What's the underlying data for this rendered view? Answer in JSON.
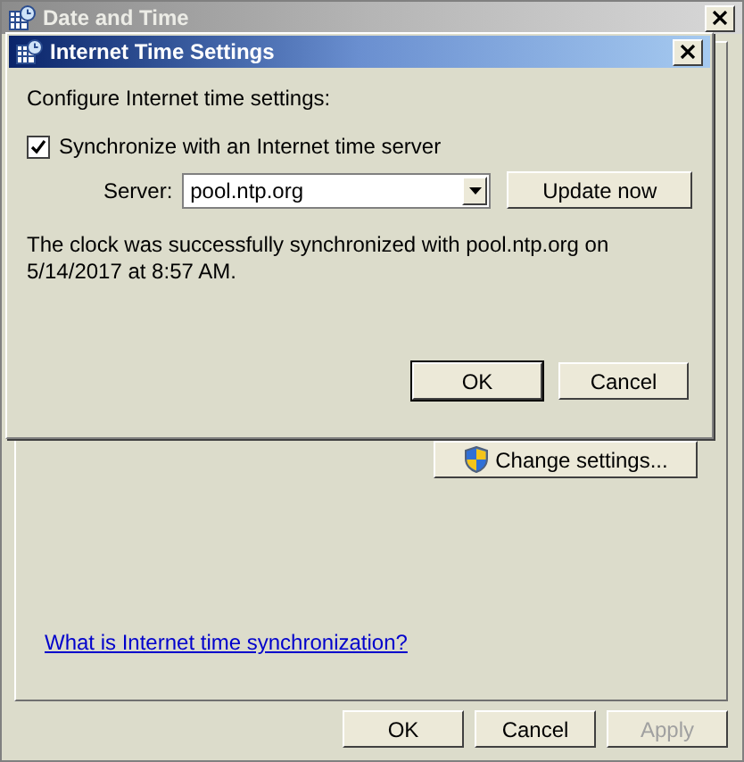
{
  "window": {
    "title": "Date and Time"
  },
  "change_settings_button": {
    "label": "Change settings..."
  },
  "help_link": "What is Internet time synchronization?",
  "buttons": [
    {
      "label": "OK",
      "disabled": false
    },
    {
      "label": "Cancel",
      "disabled": false
    },
    {
      "label": "Apply",
      "disabled": true
    }
  ],
  "dialog": {
    "title": "Internet Time Settings",
    "heading": "Configure Internet time settings:",
    "sync_checkbox": {
      "label": "Synchronize with an Internet time server",
      "checked": true
    },
    "server": {
      "label": "Server:",
      "value": "pool.ntp.org"
    },
    "update_button": "Update now",
    "message": "The clock was successfully synchronized with pool.ntp.org on 5/14/2017 at 8:57 AM.",
    "buttons": [
      {
        "label": "OK",
        "default": true
      },
      {
        "label": "Cancel",
        "default": false
      }
    ]
  }
}
